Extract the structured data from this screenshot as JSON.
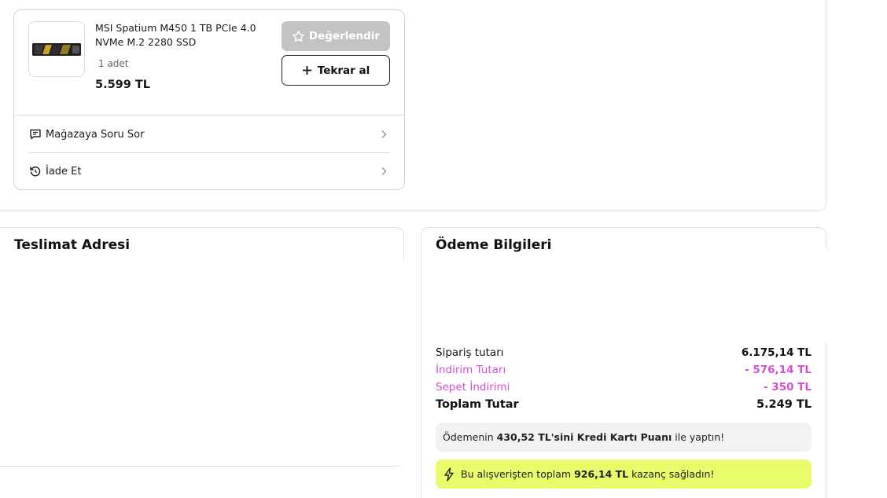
{
  "order": {
    "product": {
      "name": "MSI Spatium M450 1 TB PCIe 4.0 NVMe M.2 2280 SSD",
      "quantity": "1 adet",
      "price": "5.599 TL",
      "image_icon": "ssd-drive-icon"
    },
    "buttons": {
      "rate": "Değerlendir",
      "reorder": "Tekrar al"
    },
    "links": [
      {
        "label": "Mağazaya Soru Sor",
        "icon": "message-icon"
      },
      {
        "label": "İade Et",
        "icon": "return-icon"
      }
    ]
  },
  "delivery": {
    "title": "Teslimat Adresi"
  },
  "payment": {
    "title": "Ödeme Bilgileri",
    "rows": [
      {
        "label": "Sipariş tutarı",
        "value": "6.175,14 TL"
      },
      {
        "label": "İndirim Tutarı",
        "value": "- 576,14 TL"
      },
      {
        "label": "Sepet İndirimi",
        "value": "- 350 TL"
      },
      {
        "label": "Toplam Tutar",
        "value": "5.249 TL"
      }
    ],
    "card_points": {
      "prefix": "Ödemenin ",
      "amount": "430,52 TL'sini Kredi Kartı Puanı",
      "suffix": " ile yaptın!"
    },
    "gain": {
      "prefix": "Bu alışverişten toplam ",
      "amount": "926,14 TL",
      "suffix": " kazanç sağladın!"
    }
  },
  "colors": {
    "discount": "#d64fd0",
    "gain_background": "#e9fb6a",
    "disabled_button": "#c3c3c3"
  }
}
